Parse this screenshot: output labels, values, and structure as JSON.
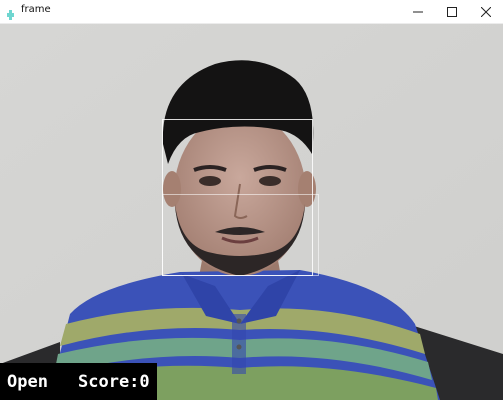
{
  "window": {
    "title": "frame",
    "icon": "app-icon",
    "controls": [
      "minimize-icon",
      "maximize-icon",
      "close-icon"
    ]
  },
  "video": {
    "subject": "person-in-webcam",
    "face_box_color": "#ffffff",
    "overlay": {
      "eye_state": "Open",
      "score_text": "Score:0"
    }
  },
  "colors": {
    "titlebar": "#ffffff",
    "overlay_background": "#000000",
    "overlay_text": "#ffffff"
  }
}
